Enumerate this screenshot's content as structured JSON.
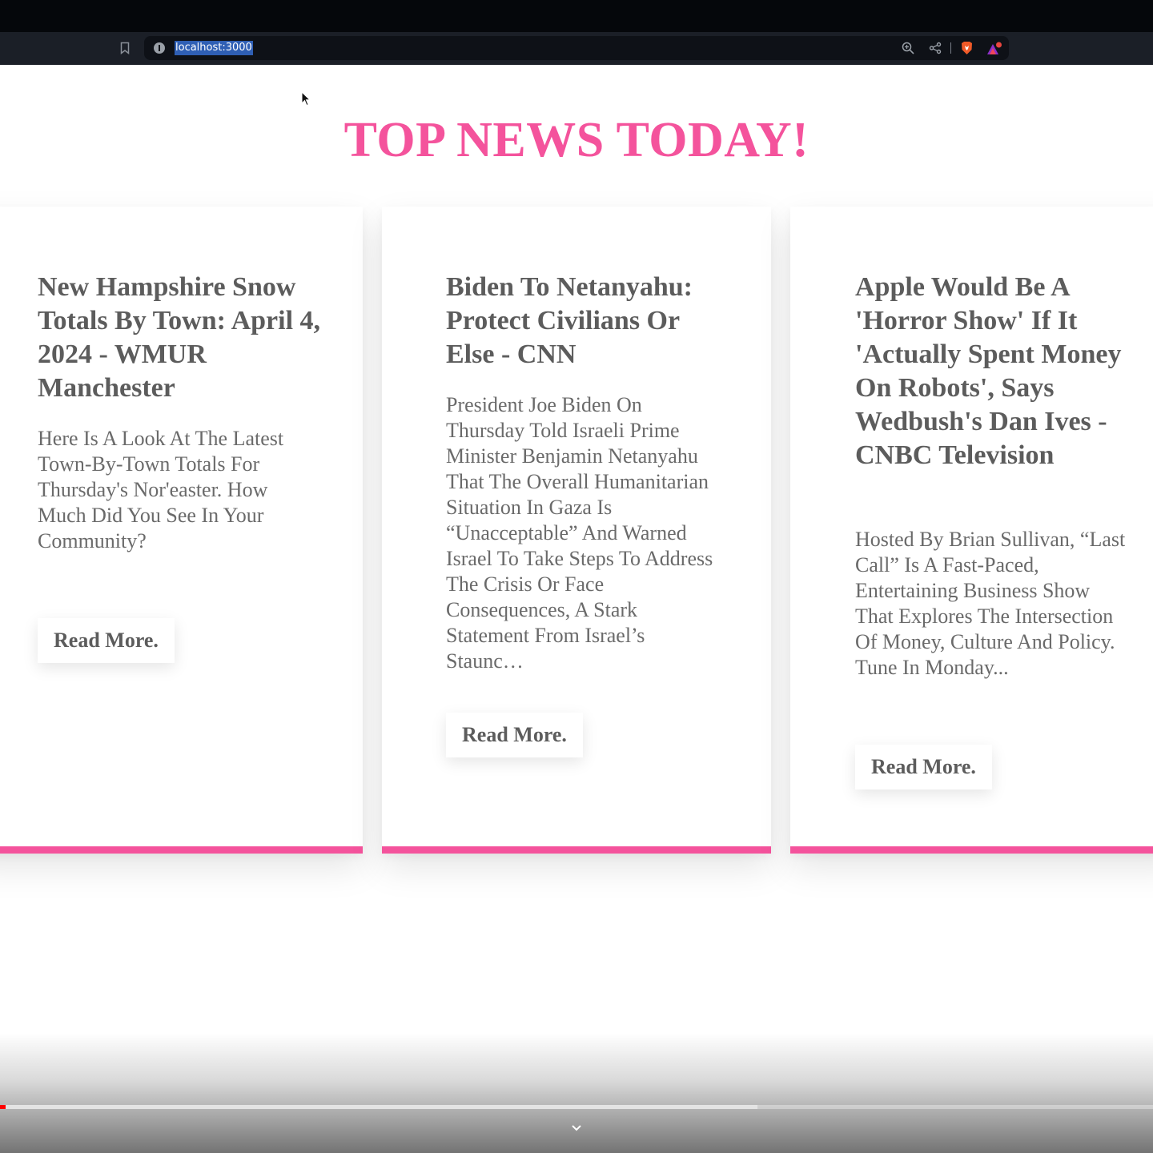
{
  "browser": {
    "url": "localhost:3000"
  },
  "page": {
    "title": "TOP NEWS TODAY!"
  },
  "articles": [
    {
      "title": "New Hampshire Snow Totals By Town: April 4, 2024 - WMUR Manchester",
      "description": "Here Is A Look At The Latest Town-By-Town Totals For Thursday's Nor'easter. How Much Did You See In Your Community?",
      "button": "Read More."
    },
    {
      "title": "Biden To Netanyahu: Protect Civilians Or Else - CNN",
      "description": "President Joe Biden On Thursday Told Israeli Prime Minister Benjamin Netanyahu That The Overall Humanitarian Situation In Gaza Is “Unacceptable” And Warned Israel To Take Steps To Address The Crisis Or Face Consequences, A Stark Statement From Israel’s Staunc…",
      "button": "Read More."
    },
    {
      "title": "Apple Would Be A 'Horror Show' If It 'Actually Spent Money On Robots', Says Wedbush's Dan Ives - CNBC Television",
      "description": "Hosted By Brian Sullivan, “Last Call” Is A Fast-Paced, Entertaining Business Show That Explores The Intersection Of Money, Culture And Policy. Tune In Monday...",
      "button": "Read More."
    }
  ],
  "video_player": {
    "played_fraction": 0.005,
    "loaded_fraction": 0.657
  },
  "colors": {
    "accent": "#f4539c",
    "text": "#5c5c5c",
    "browser_bar": "#1b1f27"
  }
}
